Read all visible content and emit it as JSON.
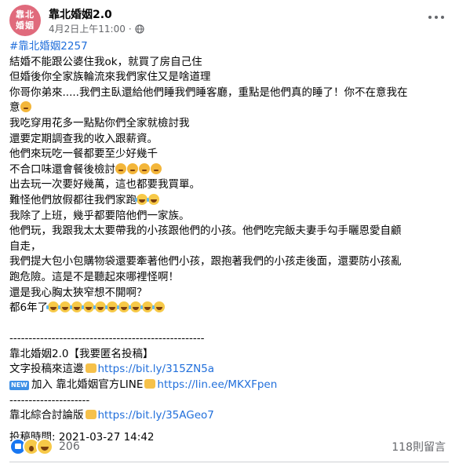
{
  "header": {
    "avatar_text": "靠北婚姻",
    "page_name": "靠北婚姻2.0",
    "timestamp": "4月2日上午11:00",
    "separator": "·"
  },
  "post": {
    "hashtag": "#靠北婚姻2257",
    "lines": [
      "結婚不能跟公婆住我ok，就買了房自己住",
      "但婚後你全家族輪流來我們家住又是啥道理",
      "你哥你弟來.....我們主臥還給他們睡我們睡客廳，重點是他們真的睡了！你不在意我在",
      "意",
      "我吃穿用花多一點點你們全家就檢討我",
      "還要定期調查我的收入跟薪資。",
      "他們來玩吃一餐都要至少好幾千",
      "不合口味還會餐後檢討",
      "出去玩一次要好幾萬，這也都要我買單。",
      "難怪他們放假都往我們家跑",
      "我除了上班，幾乎都要陪他們一家族。",
      "他們玩，我跟我太太要帶我的小孩跟他們的小孩。他們吃完飯夫妻手勾手曬恩愛自顧",
      "自走，",
      "我們提大包小包購物袋還要牽著他們小孩，跟抱著我們的小孩走後面，還要防小孩亂",
      "跑危險。這是不是聽起來哪裡怪啊！",
      "還是我心胸太狹窄想不開啊？",
      "都6年了"
    ],
    "separator_line": "---------------------------------------------------",
    "submission_title": "靠北婚姻2.0【我要匿名投稿】",
    "submission_text": "文字投稿來這邊",
    "submission_link": "https://bit.ly/315ZN5a",
    "line_badge": "NEW",
    "line_text": "加入 靠北婚姻官方LINE",
    "line_link": "https://lin.ee/MKXFpen",
    "short_separator": "---------------------",
    "forum_text": "靠北綜合討論版",
    "forum_link": "https://bit.ly/35AGeo7",
    "posted_time": "投稿時間: 2021-03-27 14:42"
  },
  "footer": {
    "reaction_count": "206",
    "comment_count": "118則留言"
  }
}
